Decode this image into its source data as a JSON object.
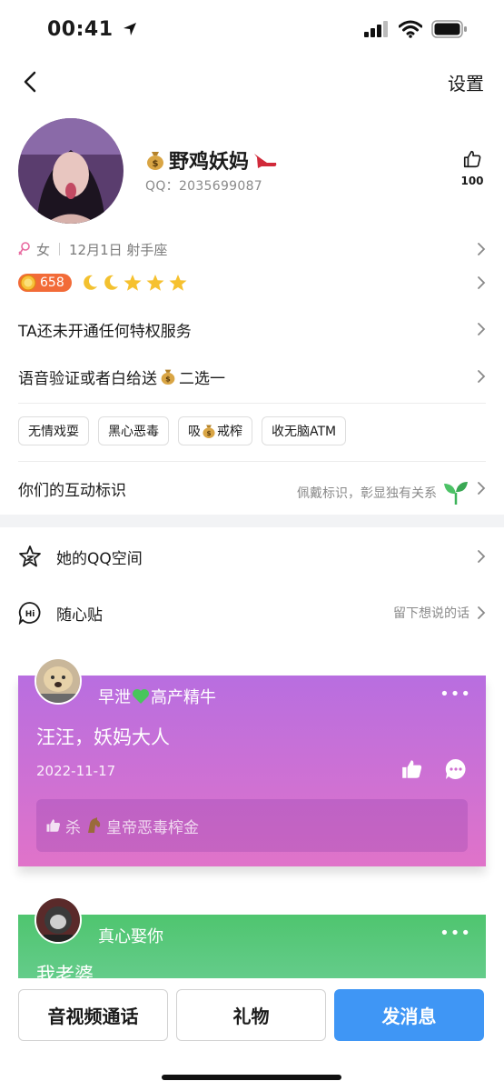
{
  "status_bar": {
    "time": "00:41"
  },
  "nav": {
    "settings_label": "设置"
  },
  "profile": {
    "nickname": "野鸡妖妈",
    "qq_label": "QQ：2035699087",
    "like_count": "100"
  },
  "info": {
    "gender": "女",
    "birthday": "12月1日 射手座"
  },
  "level": {
    "value": "658"
  },
  "privilege": {
    "text": "TA还未开通任何特权服务"
  },
  "voice": {
    "prefix": "语音验证或者白给送",
    "suffix": "二选一"
  },
  "tags": [
    {
      "label": "无情戏耍"
    },
    {
      "label": "黑心恶毒"
    },
    {
      "label_prefix": "吸",
      "label_suffix": "戒榨"
    },
    {
      "label": "收无脑ATM"
    }
  ],
  "interaction": {
    "label": "你们的互动标识",
    "hint": "佩戴标识，彰显独有关系"
  },
  "space": {
    "label": "她的QQ空间"
  },
  "notes": {
    "label": "随心贴",
    "hint": "留下想说的话"
  },
  "posts": [
    {
      "author_prefix": "早泄",
      "author_suffix": "高产精牛",
      "text": "汪汪，妖妈大人",
      "date": "2022-11-17",
      "liker_prefix": "杀",
      "liker_suffix": "皇帝恶毒榨金"
    },
    {
      "author": "真心娶你",
      "text": "我老婆"
    }
  ],
  "buttons": {
    "call": "音视频通话",
    "gift": "礼物",
    "message": "发消息"
  },
  "colors": {
    "accent": "#3f96f5",
    "level_badge": "#f26b38",
    "card1": "#c870d8",
    "card2": "#56c77a"
  }
}
